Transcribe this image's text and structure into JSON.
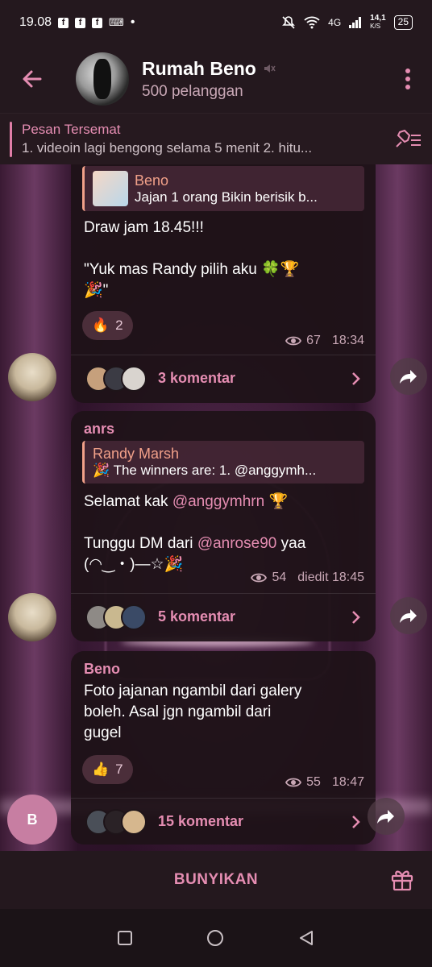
{
  "status_bar": {
    "time": "19.08",
    "network": "4G",
    "speed_value": "14,1",
    "speed_unit": "K/S",
    "battery": "25"
  },
  "header": {
    "title": "Rumah Beno",
    "subtitle": "500 pelanggan"
  },
  "pinned": {
    "title": "Pesan Tersemat",
    "text": "1. videoin lagi bengong selama 5 menit  2. hitu..."
  },
  "messages": [
    {
      "reply_name": "Beno",
      "reply_text": "Jajan 1 orang  Bikin berisik b...",
      "text_line1": "Draw jam 18.45!!!",
      "text_line2": "\"Yuk mas Randy pilih aku 🍀🏆",
      "text_line3": "🎉\"",
      "reaction_emoji": "🔥",
      "reaction_count": "2",
      "views": "67",
      "time": "18:34",
      "comments": "3 komentar"
    },
    {
      "sender": "anrs",
      "reply_name": "Randy Marsh",
      "reply_text": "🎉 The winners are:  1. @anggymh...",
      "text_line1_prefix": "Selamat kak ",
      "text_line1_mention": "@anggymhrn",
      "text_line1_suffix": " 🏆",
      "text_line2_prefix": "Tunggu DM dari ",
      "text_line2_mention": "@anrose90",
      "text_line2_suffix": " yaa",
      "text_line3": "(◠‿・)—☆🎉",
      "views": "54",
      "time": "diedit 18:45",
      "comments": "5 komentar"
    },
    {
      "sender": "Beno",
      "text_line1": "Foto jajanan ngambil dari galery",
      "text_line2": "boleh. Asal jgn ngambil dari",
      "text_line3": "gugel",
      "reaction_emoji": "👍",
      "reaction_count": "7",
      "views": "55",
      "time": "18:47",
      "comments": "15 komentar"
    }
  ],
  "fab_letter": "B",
  "bottom": {
    "unmute_label": "BUNYIKAN"
  },
  "colors": {
    "accent": "#e58db2",
    "reply_accent": "#f1a089",
    "background": "#1e1419"
  },
  "icons": [
    "back-arrow-icon",
    "mute-icon",
    "more-vert-icon",
    "unpin-list-icon",
    "eye-icon",
    "chevron-right-icon",
    "share-arrow-icon",
    "gift-icon",
    "square-nav-icon",
    "circle-nav-icon",
    "triangle-back-nav-icon"
  ]
}
